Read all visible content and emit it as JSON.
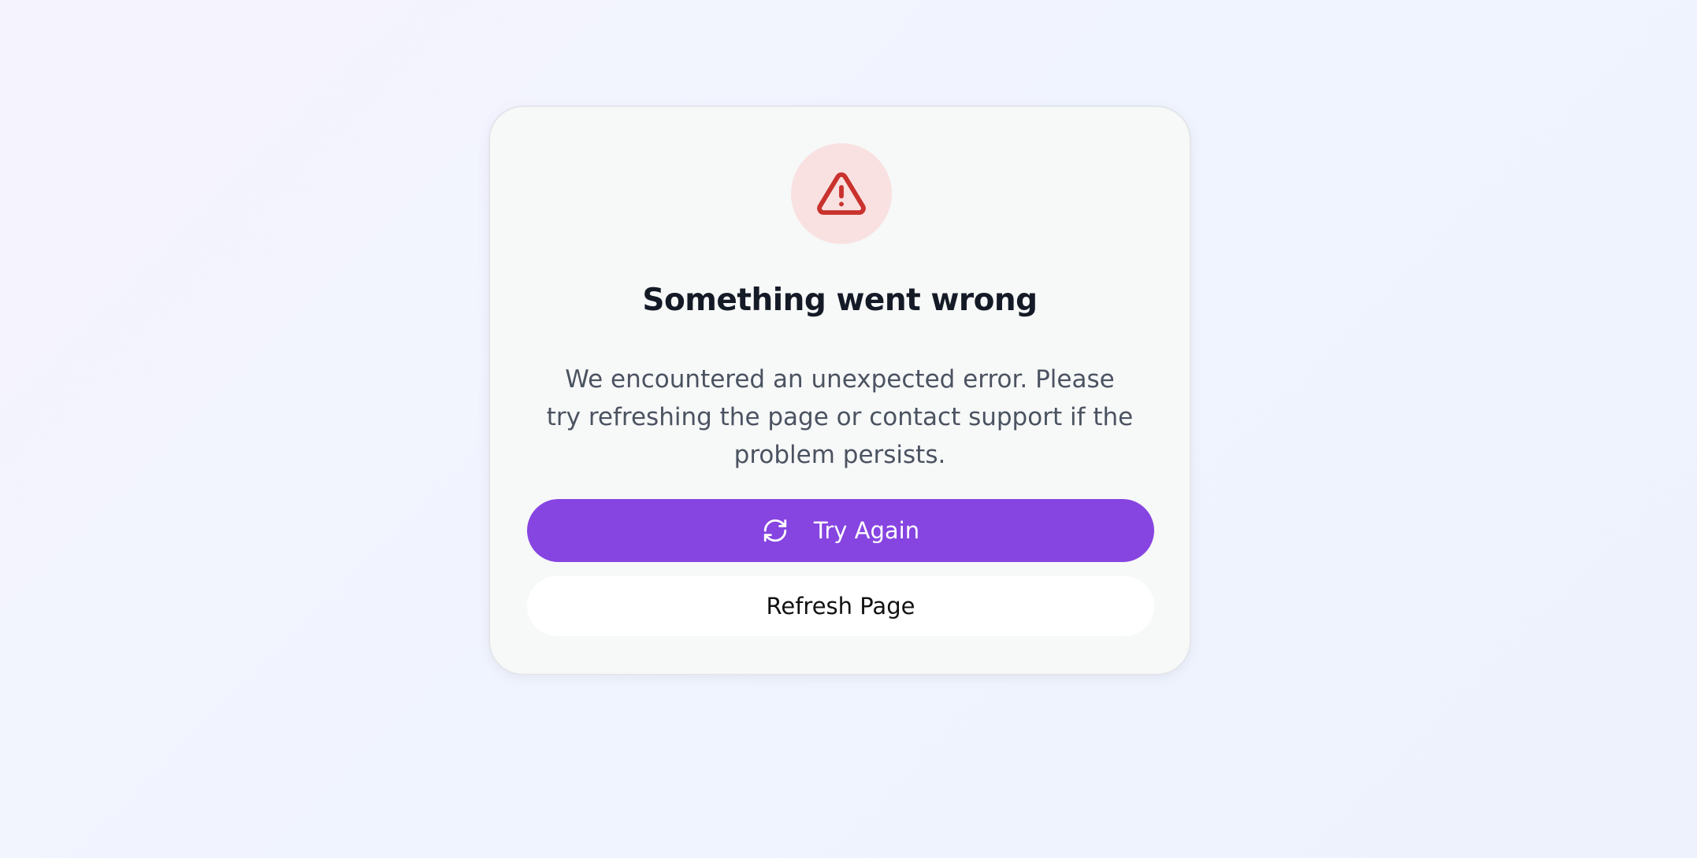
{
  "error": {
    "icon": "warning-triangle-icon",
    "title": "Something went wrong",
    "message": "We encountered an unexpected error. Please try refreshing the page or contact support if the problem persists."
  },
  "actions": {
    "try_again_label": "Try Again",
    "try_again_icon": "refresh-icon",
    "refresh_label": "Refresh Page"
  },
  "colors": {
    "accent": "#8644e1",
    "danger": "#c9322d",
    "danger_bg": "#f9e1e1"
  }
}
